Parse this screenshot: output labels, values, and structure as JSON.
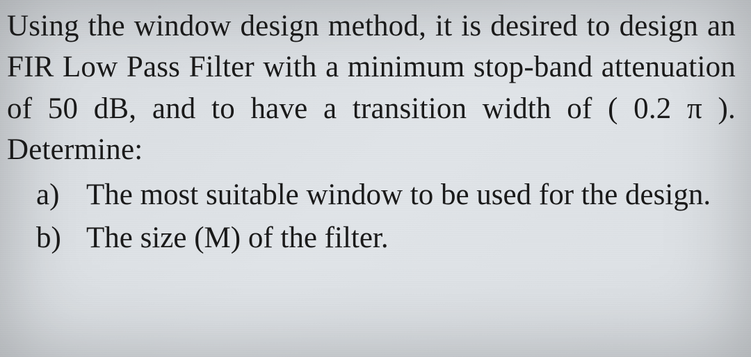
{
  "problem": {
    "intro": "Using the window design method, it is desired to design an FIR Low Pass Filter with a minimum stop-band attenuation of 50 dB, and to have a transition width of ( 0.2 π ). Determine:",
    "items": [
      {
        "marker": "a)",
        "text": "The most suitable window to be used for the design."
      },
      {
        "marker": "b)",
        "text": "The size (M) of the filter."
      }
    ]
  }
}
